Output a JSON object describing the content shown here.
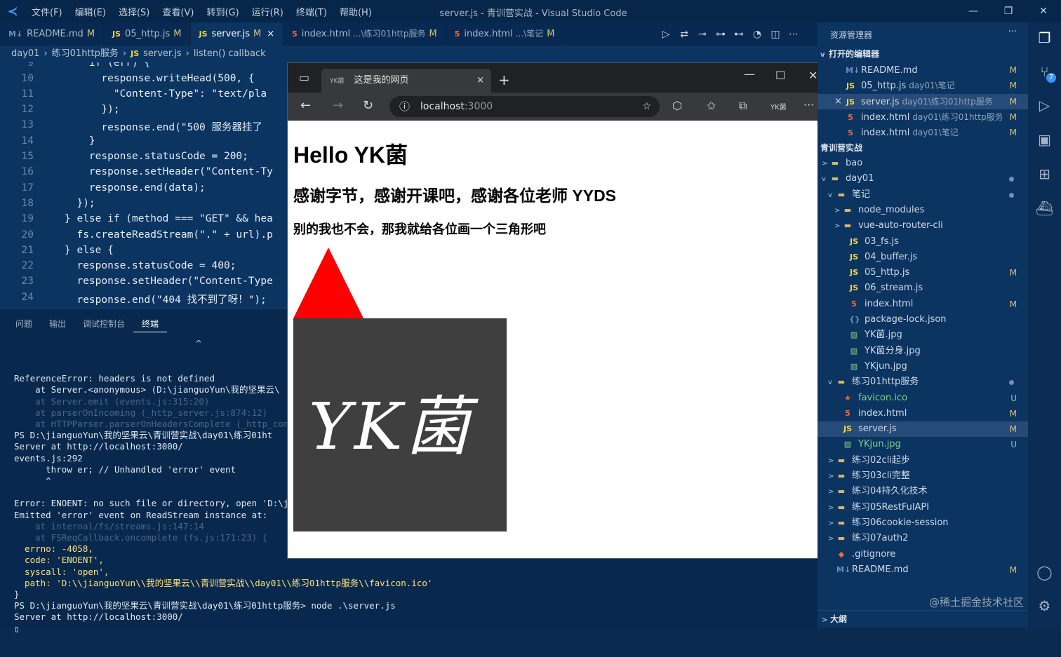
{
  "titlebar": {
    "menus": [
      "文件(F)",
      "编辑(E)",
      "选择(S)",
      "查看(V)",
      "转到(G)",
      "运行(R)",
      "终端(T)",
      "帮助(H)"
    ],
    "title": "server.js - 青训营实战 - Visual Studio Code"
  },
  "tabs": [
    {
      "icon": "M↓",
      "name": "README.md",
      "status": "M"
    },
    {
      "icon": "JS",
      "name": "05_http.js",
      "status": "M"
    },
    {
      "icon": "JS",
      "name": "server.js",
      "status": "M",
      "close": "×"
    },
    {
      "icon": "5",
      "name": "index.html",
      "desc": "...\\练习01http服务",
      "status": "M"
    },
    {
      "icon": "5",
      "name": "index.html",
      "desc": "...\\笔记",
      "status": "M"
    }
  ],
  "breadcrumb": [
    "day01",
    "›",
    "练习01http服务",
    "›",
    "JS",
    "server.js",
    "›",
    "listen() callback"
  ],
  "editor": {
    "lines": [
      "9",
      "10",
      "11",
      "12",
      "13",
      "14",
      "15",
      "16",
      "17",
      "18",
      "19",
      "20",
      "21",
      "22",
      "23",
      "24"
    ],
    "code": [
      "    if (err) {",
      "      response.writeHead(500, {",
      "        \"Content-Type\": \"text/pla",
      "      });",
      "      response.end(\"500 服务器挂了",
      "    }",
      "    response.statusCode = 200;",
      "    response.setHeader(\"Content-Ty",
      "    response.end(data);",
      "  });",
      "} else if (method === \"GET\" && hea",
      "  fs.createReadStream(\".\" + url).p",
      "} else {",
      "  response.statusCode = 400;",
      "  response.setHeader(\"Content-Type",
      "  response.end(\"404 找不到了呀！\");"
    ]
  },
  "panel": {
    "tabs": [
      "问题",
      "输出",
      "调试控制台",
      "终端"
    ],
    "active_tab": "终端",
    "caret": "^",
    "terminal": [
      "ReferenceError: headers is not defined",
      "    at Server.<anonymous> (D:\\jianguoYun\\我的坚果云\\",
      "    at Server.emit (events.js:315:20)",
      "    at parserOnIncoming (_http_server.js:874:12)",
      "    at HTTPParser.parserOnHeadersComplete (_http_com",
      "PS D:\\jianguoYun\\我的坚果云\\青训营实战\\day01\\练习01ht",
      "Server at http://localhost:3000/",
      "events.js:292",
      "      throw er; // Unhandled 'error' event",
      "      ^",
      "",
      "Error: ENOENT: no such file or directory, open 'D:\\j",
      "Emitted 'error' event on ReadStream instance at:",
      "    at internal/fs/streams.js:147:14",
      "    at FSReqCallback.oncomplete (fs.js:171:23) {",
      "  errno: -4058,",
      "  code: 'ENOENT',",
      "  syscall: 'open',",
      "  path: 'D:\\\\jianguoYun\\\\我的坚果云\\\\青训营实战\\\\day01\\\\练习01http服务\\\\favicon.ico'",
      "}",
      "PS D:\\jianguoYun\\我的坚果云\\青训营实战\\day01\\练习01http服务> node .\\server.js",
      "Server at http://localhost:3000/",
      "▯"
    ]
  },
  "browser": {
    "tab_title": "这是我的网页",
    "tab_close": "×",
    "new_tab": "+",
    "url_host": "localhost",
    "url_port": ":3000",
    "profile": "YK菌",
    "more": "···",
    "page": {
      "h1": "Hello YK菌",
      "h2": "感谢字节，感谢开课吧，感谢各位老师 YYDS",
      "h3": "别的我也不会，那我就给各位画一个三角形吧",
      "triangle_color": "#ff0000",
      "image_text": "YK菌"
    }
  },
  "explorer": {
    "header": "资源管理器",
    "more": "···",
    "open_editors_label": "打开的编辑器",
    "open_editors": [
      {
        "icon": "M↓",
        "name": "README.md",
        "desc": "",
        "status": "M"
      },
      {
        "icon": "JS",
        "name": "05_http.js",
        "desc": "day01\\笔记",
        "status": "M"
      },
      {
        "icon": "JS",
        "name": "server.js",
        "desc": "day01\\练习01http服务",
        "status": "M",
        "close": "×"
      },
      {
        "icon": "5",
        "name": "index.html",
        "desc": "day01\\练习01http服务",
        "status": "M"
      },
      {
        "icon": "5",
        "name": "index.html",
        "desc": "day01\\笔记",
        "status": "M"
      }
    ],
    "workspace_label": "青训营实战",
    "tree": [
      {
        "name": "bao",
        "type": "folder",
        "chev": ">"
      },
      {
        "name": "day01",
        "type": "folder",
        "chev": "v",
        "dot": true
      },
      {
        "name": "笔记",
        "type": "folder",
        "chev": "v",
        "dot": true
      },
      {
        "name": "node_modules",
        "type": "folder",
        "chev": ">"
      },
      {
        "name": "vue-auto-router-cli",
        "type": "folder",
        "chev": ">"
      },
      {
        "name": "03_fs.js",
        "type": "js"
      },
      {
        "name": "04_buffer.js",
        "type": "js"
      },
      {
        "name": "05_http.js",
        "type": "js",
        "status": "M"
      },
      {
        "name": "06_stream.js",
        "type": "js"
      },
      {
        "name": "index.html",
        "type": "html",
        "status": "M"
      },
      {
        "name": "package-lock.json",
        "type": "json"
      },
      {
        "name": "YK菌.jpg",
        "type": "img"
      },
      {
        "name": "YK菌分身.jpg",
        "type": "img"
      },
      {
        "name": "YKjun.jpg",
        "type": "img"
      },
      {
        "name": "练习01http服务",
        "type": "folder",
        "chev": "v",
        "dot": true
      },
      {
        "name": "favicon.ico",
        "type": "ico",
        "status": "U"
      },
      {
        "name": "index.html",
        "type": "html",
        "status": "M"
      },
      {
        "name": "server.js",
        "type": "js",
        "status": "M"
      },
      {
        "name": "YKjun.jpg",
        "type": "img",
        "status": "U"
      },
      {
        "name": "练习02cli起步",
        "type": "folder",
        "chev": ">"
      },
      {
        "name": "练习03cli完整",
        "type": "folder",
        "chev": ">"
      },
      {
        "name": "练习04持久化技术",
        "type": "folder",
        "chev": ">"
      },
      {
        "name": "练习05RestFulAPI",
        "type": "folder",
        "chev": ">"
      },
      {
        "name": "练习06cookie-session",
        "type": "folder",
        "chev": ">"
      },
      {
        "name": "练习07auth2",
        "type": "folder",
        "chev": ">"
      },
      {
        "name": ".gitignore",
        "type": "git"
      },
      {
        "name": "README.md",
        "type": "md",
        "status": "M"
      }
    ],
    "outline_label": "大纲",
    "outline_chev": ">"
  },
  "activity": {
    "scm_badge": "7"
  },
  "watermark": "@稀土掘金技术社区"
}
